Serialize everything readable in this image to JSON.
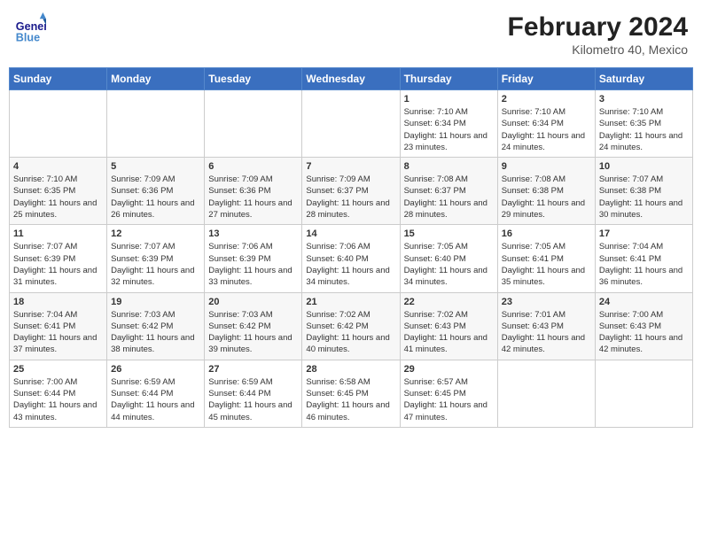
{
  "header": {
    "logo_general": "General",
    "logo_blue": "Blue",
    "month_year": "February 2024",
    "location": "Kilometro 40, Mexico"
  },
  "days_of_week": [
    "Sunday",
    "Monday",
    "Tuesday",
    "Wednesday",
    "Thursday",
    "Friday",
    "Saturday"
  ],
  "weeks": [
    [
      {
        "day": "",
        "info": ""
      },
      {
        "day": "",
        "info": ""
      },
      {
        "day": "",
        "info": ""
      },
      {
        "day": "",
        "info": ""
      },
      {
        "day": "1",
        "info": "Sunrise: 7:10 AM\nSunset: 6:34 PM\nDaylight: 11 hours and 23 minutes."
      },
      {
        "day": "2",
        "info": "Sunrise: 7:10 AM\nSunset: 6:34 PM\nDaylight: 11 hours and 24 minutes."
      },
      {
        "day": "3",
        "info": "Sunrise: 7:10 AM\nSunset: 6:35 PM\nDaylight: 11 hours and 24 minutes."
      }
    ],
    [
      {
        "day": "4",
        "info": "Sunrise: 7:10 AM\nSunset: 6:35 PM\nDaylight: 11 hours and 25 minutes."
      },
      {
        "day": "5",
        "info": "Sunrise: 7:09 AM\nSunset: 6:36 PM\nDaylight: 11 hours and 26 minutes."
      },
      {
        "day": "6",
        "info": "Sunrise: 7:09 AM\nSunset: 6:36 PM\nDaylight: 11 hours and 27 minutes."
      },
      {
        "day": "7",
        "info": "Sunrise: 7:09 AM\nSunset: 6:37 PM\nDaylight: 11 hours and 28 minutes."
      },
      {
        "day": "8",
        "info": "Sunrise: 7:08 AM\nSunset: 6:37 PM\nDaylight: 11 hours and 28 minutes."
      },
      {
        "day": "9",
        "info": "Sunrise: 7:08 AM\nSunset: 6:38 PM\nDaylight: 11 hours and 29 minutes."
      },
      {
        "day": "10",
        "info": "Sunrise: 7:07 AM\nSunset: 6:38 PM\nDaylight: 11 hours and 30 minutes."
      }
    ],
    [
      {
        "day": "11",
        "info": "Sunrise: 7:07 AM\nSunset: 6:39 PM\nDaylight: 11 hours and 31 minutes."
      },
      {
        "day": "12",
        "info": "Sunrise: 7:07 AM\nSunset: 6:39 PM\nDaylight: 11 hours and 32 minutes."
      },
      {
        "day": "13",
        "info": "Sunrise: 7:06 AM\nSunset: 6:39 PM\nDaylight: 11 hours and 33 minutes."
      },
      {
        "day": "14",
        "info": "Sunrise: 7:06 AM\nSunset: 6:40 PM\nDaylight: 11 hours and 34 minutes."
      },
      {
        "day": "15",
        "info": "Sunrise: 7:05 AM\nSunset: 6:40 PM\nDaylight: 11 hours and 34 minutes."
      },
      {
        "day": "16",
        "info": "Sunrise: 7:05 AM\nSunset: 6:41 PM\nDaylight: 11 hours and 35 minutes."
      },
      {
        "day": "17",
        "info": "Sunrise: 7:04 AM\nSunset: 6:41 PM\nDaylight: 11 hours and 36 minutes."
      }
    ],
    [
      {
        "day": "18",
        "info": "Sunrise: 7:04 AM\nSunset: 6:41 PM\nDaylight: 11 hours and 37 minutes."
      },
      {
        "day": "19",
        "info": "Sunrise: 7:03 AM\nSunset: 6:42 PM\nDaylight: 11 hours and 38 minutes."
      },
      {
        "day": "20",
        "info": "Sunrise: 7:03 AM\nSunset: 6:42 PM\nDaylight: 11 hours and 39 minutes."
      },
      {
        "day": "21",
        "info": "Sunrise: 7:02 AM\nSunset: 6:42 PM\nDaylight: 11 hours and 40 minutes."
      },
      {
        "day": "22",
        "info": "Sunrise: 7:02 AM\nSunset: 6:43 PM\nDaylight: 11 hours and 41 minutes."
      },
      {
        "day": "23",
        "info": "Sunrise: 7:01 AM\nSunset: 6:43 PM\nDaylight: 11 hours and 42 minutes."
      },
      {
        "day": "24",
        "info": "Sunrise: 7:00 AM\nSunset: 6:43 PM\nDaylight: 11 hours and 42 minutes."
      }
    ],
    [
      {
        "day": "25",
        "info": "Sunrise: 7:00 AM\nSunset: 6:44 PM\nDaylight: 11 hours and 43 minutes."
      },
      {
        "day": "26",
        "info": "Sunrise: 6:59 AM\nSunset: 6:44 PM\nDaylight: 11 hours and 44 minutes."
      },
      {
        "day": "27",
        "info": "Sunrise: 6:59 AM\nSunset: 6:44 PM\nDaylight: 11 hours and 45 minutes."
      },
      {
        "day": "28",
        "info": "Sunrise: 6:58 AM\nSunset: 6:45 PM\nDaylight: 11 hours and 46 minutes."
      },
      {
        "day": "29",
        "info": "Sunrise: 6:57 AM\nSunset: 6:45 PM\nDaylight: 11 hours and 47 minutes."
      },
      {
        "day": "",
        "info": ""
      },
      {
        "day": "",
        "info": ""
      }
    ]
  ]
}
